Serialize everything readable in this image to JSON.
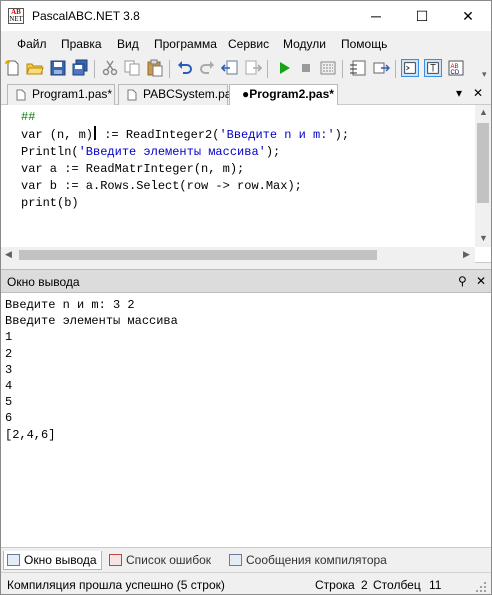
{
  "window": {
    "title": "PascalABC.NET 3.8",
    "icon_text_top": "AB",
    "icon_text_bottom": "NET",
    "minimize": "─",
    "maximize": "☐",
    "close": "✕"
  },
  "menu": [
    "Файл",
    "Правка",
    "Вид",
    "Программа",
    "Сервис",
    "Модули",
    "Помощь"
  ],
  "toolbar": {
    "icons": [
      "new-file-icon",
      "open-folder-icon",
      "save-icon",
      "save-all-icon",
      "cut-icon",
      "copy-icon",
      "paste-icon",
      "undo-icon",
      "redo-icon",
      "back-icon",
      "forward-icon",
      "run-icon",
      "stop-icon",
      "compile-icon",
      "debug-window-icon",
      "watch-icon",
      "output-panel-icon",
      "find-icon",
      "abc-icon"
    ]
  },
  "tabs": [
    {
      "label": "Program1.pas*"
    },
    {
      "label": "PABCSystem.pas"
    },
    {
      "label": "●Program2.pas*"
    }
  ],
  "tab_controls": {
    "dropdown": "▾",
    "close": "✕"
  },
  "editor": {
    "lines": [
      {
        "parts": [
          {
            "t": "##",
            "c": "cm"
          }
        ]
      },
      {
        "parts": [
          {
            "t": "var (n, m)",
            "c": "kw"
          },
          {
            "t": "|caret|",
            "c": "caret"
          },
          {
            "t": " := ReadInteger2(",
            "c": "kw"
          },
          {
            "t": "'Введите n и m:'",
            "c": "str"
          },
          {
            "t": ");",
            "c": "kw"
          }
        ]
      },
      {
        "parts": [
          {
            "t": "Println(",
            "c": "kw"
          },
          {
            "t": "'Введите элементы массива'",
            "c": "str"
          },
          {
            "t": ");",
            "c": "kw"
          }
        ]
      },
      {
        "parts": [
          {
            "t": "var a := ReadMatrInteger(n, m);",
            "c": "kw"
          }
        ]
      },
      {
        "parts": [
          {
            "t": "var b := a.Rows.Select(row -> row.Max);",
            "c": "kw"
          }
        ]
      },
      {
        "parts": [
          {
            "t": "print(b)",
            "c": "kw"
          }
        ]
      }
    ]
  },
  "output_panel": {
    "title": "Окно вывода",
    "pin": "⚲",
    "close": "✕",
    "lines": [
      "Введите n и m: 3 2",
      "Введите элементы массива",
      "1",
      "2",
      "3",
      "4",
      "5",
      "6",
      "[2,4,6]"
    ]
  },
  "bottom_tabs": [
    {
      "label": "Окно вывода"
    },
    {
      "label": "Список ошибок"
    },
    {
      "label": "Сообщения компилятора"
    }
  ],
  "status": {
    "message": "Компиляция прошла успешно (5 строк)",
    "row_label": "Строка",
    "row_value": "2",
    "col_label": "Столбец",
    "col_value": "11"
  },
  "colors": {
    "string": "#0000c8",
    "comment": "#008000",
    "run": "#17a317"
  }
}
